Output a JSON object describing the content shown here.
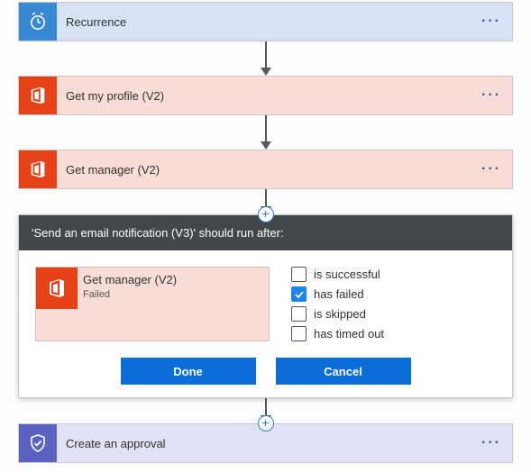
{
  "steps": {
    "recurrence": {
      "title": "Recurrence"
    },
    "get_profile": {
      "title": "Get my profile (V2)"
    },
    "get_manager": {
      "title": "Get manager (V2)"
    },
    "create_approval": {
      "title": "Create an approval"
    }
  },
  "run_after_panel": {
    "header": "'Send an email notification (V3)' should run after:",
    "predecessor": {
      "title": "Get manager (V2)",
      "status": "Failed"
    },
    "conditions": {
      "successful": {
        "label": "is successful",
        "checked": false
      },
      "failed": {
        "label": "has failed",
        "checked": true
      },
      "skipped": {
        "label": "is skipped",
        "checked": false
      },
      "timed_out": {
        "label": "has timed out",
        "checked": false
      }
    },
    "buttons": {
      "done": "Done",
      "cancel": "Cancel"
    }
  }
}
